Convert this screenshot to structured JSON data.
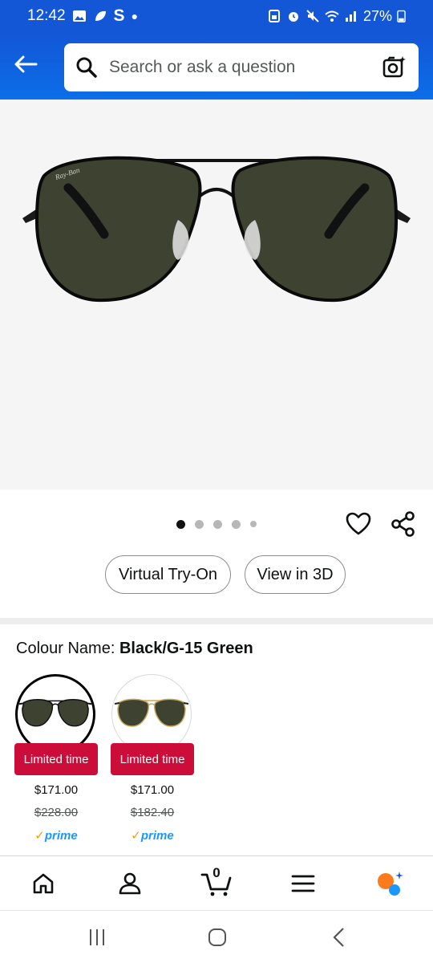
{
  "status_bar": {
    "time": "12:42",
    "notification_letter": "S",
    "battery": "27%"
  },
  "header": {
    "search_placeholder": "Search or ask a question",
    "back_icon": "back-arrow-icon",
    "camera_icon": "camera-search-icon"
  },
  "carousel": {
    "dot_count": 5,
    "active_index": 0
  },
  "actions": {
    "virtual_try_on": "Virtual Try-On",
    "view_3d": "View in 3D"
  },
  "colour": {
    "label": "Colour Name:",
    "value": "Black/G-15 Green"
  },
  "swatches": [
    {
      "badge": "Limited time",
      "price": "$171.00",
      "old_price": "$228.00",
      "prime": "prime",
      "selected": true,
      "frame_color": "#111111"
    },
    {
      "badge": "Limited time",
      "price": "$171.00",
      "old_price": "$182.40",
      "prime": "prime",
      "selected": false,
      "frame_color": "#c9a860"
    }
  ],
  "bottom_nav": {
    "cart_count": "0",
    "items": [
      "home-icon",
      "account-icon",
      "cart-icon",
      "menu-icon",
      "rufus-icon"
    ]
  },
  "colors": {
    "header_blue": "#1356d6",
    "badge_red": "#cc0c39",
    "prime_blue": "#1a98ff",
    "prime_orange": "#ff9900",
    "lens_green": "#3a3f2e"
  }
}
